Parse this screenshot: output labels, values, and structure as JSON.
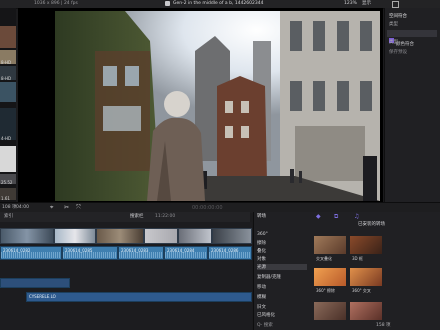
{
  "app": {
    "format_info": "1036 x 896 | 24 fps",
    "window_title": "Gen-2 in the middle of a b, 1442602344",
    "zoom": "123%",
    "view_menu": "显示"
  },
  "browser": {
    "clips": [
      {
        "label": "",
        "color": "#6b4a3a"
      },
      {
        "label": "8-HD",
        "color": "#8a7b63"
      },
      {
        "label": "8-HD",
        "color": "#2f3840"
      },
      {
        "label": "",
        "color": "#3b5363"
      },
      {
        "label": "4-HD",
        "color": "#1f2a33"
      },
      {
        "label": "",
        "color": "#d8d8d8"
      },
      {
        "label": "25.52",
        "color": "#4a4a4e"
      },
      {
        "label": "1.61",
        "color": "#3f3a35"
      }
    ],
    "selection": "108 项",
    "duration": "04:00"
  },
  "viewer": {
    "timecode": "00:00:00:00",
    "scene_colors": {
      "sky": "#e8eef4",
      "building": "#7a6a5a",
      "street": "#3c3a38",
      "coat": "#6e5f55"
    }
  },
  "inspector": {
    "title": "空间符合",
    "rows": [
      {
        "label": "类型",
        "selected": false
      },
      {
        "label": "颜色符合",
        "selected": true
      },
      {
        "label": "类型",
        "selected": false
      },
      {
        "label": "保存预设",
        "selected": false
      }
    ]
  },
  "timeline": {
    "index_label": "索引",
    "project_name": "搜索栏",
    "timecode": "11:22:00",
    "video_clips": 6,
    "audio_clips": [
      {
        "name": "230614_0282"
      },
      {
        "name": "230614_0285"
      },
      {
        "name": "230614_0283"
      },
      {
        "name": "230614_0284"
      },
      {
        "name": "230614_0286"
      }
    ],
    "music_clip": "CYSERELE.LO"
  },
  "effects": {
    "header": "转场",
    "installed": "已安装的转场",
    "categories": [
      {
        "label": "360°",
        "selected": false
      },
      {
        "label": "擦除",
        "selected": false
      },
      {
        "label": "叠化",
        "selected": false
      },
      {
        "label": "对象",
        "selected": true
      },
      {
        "label": "光源",
        "selected": false
      },
      {
        "label": "复制器/克隆",
        "selected": false
      },
      {
        "label": "移动",
        "selected": false
      },
      {
        "label": "模糊",
        "selected": false
      },
      {
        "label": "旧文",
        "selected": false
      },
      {
        "label": "已风格化",
        "selected": false
      }
    ],
    "thumbs": [
      {
        "label": "交叉叠化",
        "color": "#7a5a45"
      },
      {
        "label": "3D 框",
        "color": "#5a3a2a"
      },
      {
        "label": "360° 擦除",
        "color": "#d87a3a"
      },
      {
        "label": "360° 交叉",
        "color": "#a86a3a"
      },
      {
        "label": "",
        "color": "#6a4a3a"
      },
      {
        "label": "",
        "color": "#8a5a4a"
      }
    ],
    "count": "158 项",
    "search_placeholder": "Q- 搜索"
  }
}
